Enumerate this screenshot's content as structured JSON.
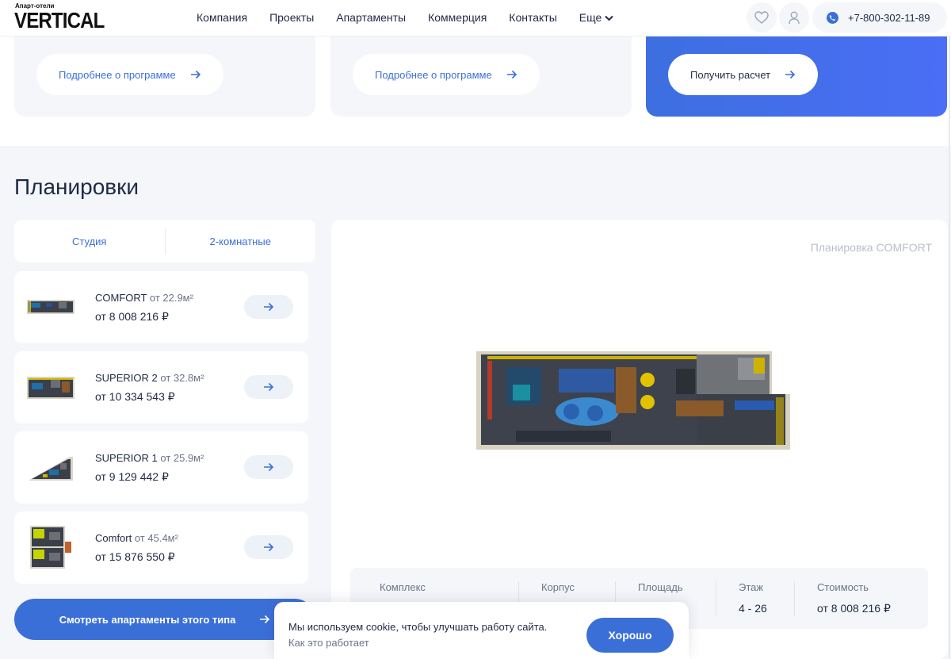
{
  "header": {
    "logo_small": "Апарт-отели",
    "logo_big": "VERTICAL",
    "nav": [
      "Компания",
      "Проекты",
      "Апартаменты",
      "Коммерция",
      "Контакты"
    ],
    "more": "Еще",
    "phone": "+7-800-302-11-89"
  },
  "top_cards": {
    "card1_button": "Подробнее о программе",
    "card2_button": "Подробнее о программе",
    "card3_button": "Получить расчет"
  },
  "section_title": "Планировки",
  "tabs": [
    "Студия",
    "2-комнатные"
  ],
  "layouts": [
    {
      "name": "COMFORT",
      "area": "от 22.9м²",
      "price": "от 8 008 216 ₽"
    },
    {
      "name": "SUPERIOR 2",
      "area": "от 32.8м²",
      "price": "от 10 334 543 ₽"
    },
    {
      "name": "SUPERIOR 1",
      "area": "от 25.9м²",
      "price": "от 9 129 442 ₽"
    },
    {
      "name": "Comfort",
      "area": "от 45.4м²",
      "price": "от 15 876 550 ₽"
    }
  ],
  "cta": "Смотреть апартаменты этого типа",
  "panel": {
    "title": "Планировка COMFORT",
    "columns": [
      {
        "label": "Комплекс",
        "value": ""
      },
      {
        "label": "Корпус",
        "value": ""
      },
      {
        "label": "Площадь",
        "value": "²"
      },
      {
        "label": "Этаж",
        "value": "4 - 26"
      },
      {
        "label": "Стоимость",
        "value": "от 8 008 216 ₽"
      }
    ]
  },
  "cookie": {
    "text": "Мы используем cookie, чтобы улучшать работу сайта.",
    "link": "Как это работает",
    "button": "Хорошо"
  },
  "colors": {
    "accent": "#3b6fd8",
    "bg": "#f4f6fa"
  }
}
